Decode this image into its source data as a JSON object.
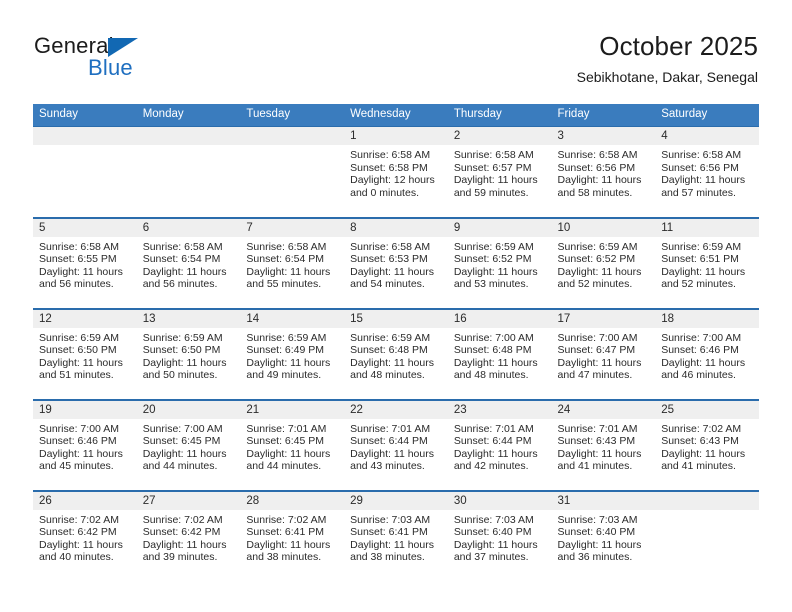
{
  "brand": {
    "name_part1": "General",
    "name_part2": "Blue",
    "flag_icon": "blue-triangle-flag-icon",
    "accent_color": "#1268b3"
  },
  "header": {
    "title": "October 2025",
    "subtitle": "Sebikhotane, Dakar, Senegal"
  },
  "theme": {
    "header_row_bg": "#3a7cbe",
    "row_divider": "#2a6cac",
    "daynum_bg": "#efefef",
    "text": "#2b2b2b"
  },
  "weekdays": [
    "Sunday",
    "Monday",
    "Tuesday",
    "Wednesday",
    "Thursday",
    "Friday",
    "Saturday"
  ],
  "weeks": [
    [
      {
        "day": "",
        "text": ""
      },
      {
        "day": "",
        "text": ""
      },
      {
        "day": "",
        "text": ""
      },
      {
        "day": "1",
        "text": "Sunrise: 6:58 AM\nSunset: 6:58 PM\nDaylight: 12 hours\nand 0 minutes."
      },
      {
        "day": "2",
        "text": "Sunrise: 6:58 AM\nSunset: 6:57 PM\nDaylight: 11 hours\nand 59 minutes."
      },
      {
        "day": "3",
        "text": "Sunrise: 6:58 AM\nSunset: 6:56 PM\nDaylight: 11 hours\nand 58 minutes."
      },
      {
        "day": "4",
        "text": "Sunrise: 6:58 AM\nSunset: 6:56 PM\nDaylight: 11 hours\nand 57 minutes."
      }
    ],
    [
      {
        "day": "5",
        "text": "Sunrise: 6:58 AM\nSunset: 6:55 PM\nDaylight: 11 hours\nand 56 minutes."
      },
      {
        "day": "6",
        "text": "Sunrise: 6:58 AM\nSunset: 6:54 PM\nDaylight: 11 hours\nand 56 minutes."
      },
      {
        "day": "7",
        "text": "Sunrise: 6:58 AM\nSunset: 6:54 PM\nDaylight: 11 hours\nand 55 minutes."
      },
      {
        "day": "8",
        "text": "Sunrise: 6:58 AM\nSunset: 6:53 PM\nDaylight: 11 hours\nand 54 minutes."
      },
      {
        "day": "9",
        "text": "Sunrise: 6:59 AM\nSunset: 6:52 PM\nDaylight: 11 hours\nand 53 minutes."
      },
      {
        "day": "10",
        "text": "Sunrise: 6:59 AM\nSunset: 6:52 PM\nDaylight: 11 hours\nand 52 minutes."
      },
      {
        "day": "11",
        "text": "Sunrise: 6:59 AM\nSunset: 6:51 PM\nDaylight: 11 hours\nand 52 minutes."
      }
    ],
    [
      {
        "day": "12",
        "text": "Sunrise: 6:59 AM\nSunset: 6:50 PM\nDaylight: 11 hours\nand 51 minutes."
      },
      {
        "day": "13",
        "text": "Sunrise: 6:59 AM\nSunset: 6:50 PM\nDaylight: 11 hours\nand 50 minutes."
      },
      {
        "day": "14",
        "text": "Sunrise: 6:59 AM\nSunset: 6:49 PM\nDaylight: 11 hours\nand 49 minutes."
      },
      {
        "day": "15",
        "text": "Sunrise: 6:59 AM\nSunset: 6:48 PM\nDaylight: 11 hours\nand 48 minutes."
      },
      {
        "day": "16",
        "text": "Sunrise: 7:00 AM\nSunset: 6:48 PM\nDaylight: 11 hours\nand 48 minutes."
      },
      {
        "day": "17",
        "text": "Sunrise: 7:00 AM\nSunset: 6:47 PM\nDaylight: 11 hours\nand 47 minutes."
      },
      {
        "day": "18",
        "text": "Sunrise: 7:00 AM\nSunset: 6:46 PM\nDaylight: 11 hours\nand 46 minutes."
      }
    ],
    [
      {
        "day": "19",
        "text": "Sunrise: 7:00 AM\nSunset: 6:46 PM\nDaylight: 11 hours\nand 45 minutes."
      },
      {
        "day": "20",
        "text": "Sunrise: 7:00 AM\nSunset: 6:45 PM\nDaylight: 11 hours\nand 44 minutes."
      },
      {
        "day": "21",
        "text": "Sunrise: 7:01 AM\nSunset: 6:45 PM\nDaylight: 11 hours\nand 44 minutes."
      },
      {
        "day": "22",
        "text": "Sunrise: 7:01 AM\nSunset: 6:44 PM\nDaylight: 11 hours\nand 43 minutes."
      },
      {
        "day": "23",
        "text": "Sunrise: 7:01 AM\nSunset: 6:44 PM\nDaylight: 11 hours\nand 42 minutes."
      },
      {
        "day": "24",
        "text": "Sunrise: 7:01 AM\nSunset: 6:43 PM\nDaylight: 11 hours\nand 41 minutes."
      },
      {
        "day": "25",
        "text": "Sunrise: 7:02 AM\nSunset: 6:43 PM\nDaylight: 11 hours\nand 41 minutes."
      }
    ],
    [
      {
        "day": "26",
        "text": "Sunrise: 7:02 AM\nSunset: 6:42 PM\nDaylight: 11 hours\nand 40 minutes."
      },
      {
        "day": "27",
        "text": "Sunrise: 7:02 AM\nSunset: 6:42 PM\nDaylight: 11 hours\nand 39 minutes."
      },
      {
        "day": "28",
        "text": "Sunrise: 7:02 AM\nSunset: 6:41 PM\nDaylight: 11 hours\nand 38 minutes."
      },
      {
        "day": "29",
        "text": "Sunrise: 7:03 AM\nSunset: 6:41 PM\nDaylight: 11 hours\nand 38 minutes."
      },
      {
        "day": "30",
        "text": "Sunrise: 7:03 AM\nSunset: 6:40 PM\nDaylight: 11 hours\nand 37 minutes."
      },
      {
        "day": "31",
        "text": "Sunrise: 7:03 AM\nSunset: 6:40 PM\nDaylight: 11 hours\nand 36 minutes."
      },
      {
        "day": "",
        "text": ""
      }
    ]
  ]
}
